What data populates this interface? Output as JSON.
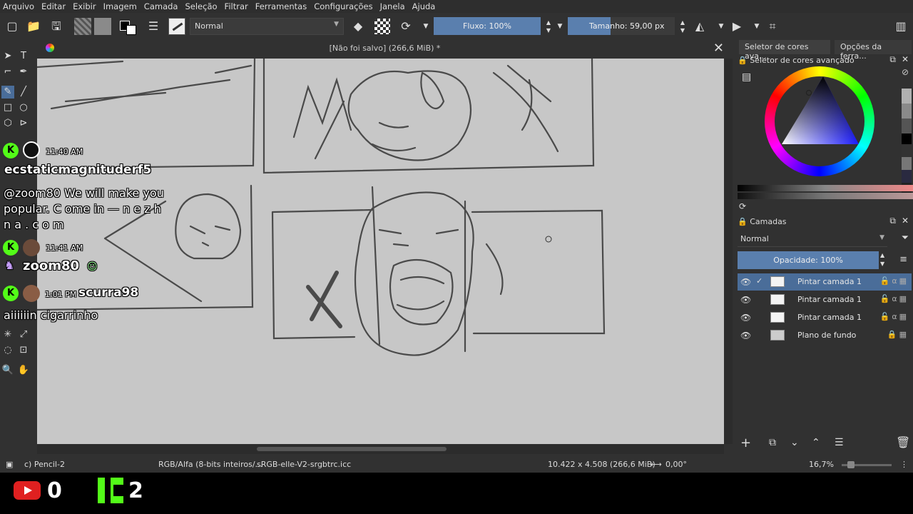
{
  "menu": [
    "Arquivo",
    "Editar",
    "Exibir",
    "Imagem",
    "Camada",
    "Seleção",
    "Filtrar",
    "Ferramentas",
    "Configurações",
    "Janela",
    "Ajuda"
  ],
  "toolbar": {
    "blend_mode": "Normal",
    "flow_label": "Fluxo: 100%",
    "size_label": "Tamanho: 59,00 px"
  },
  "document": {
    "title": "[Não foi salvo]  (266,6 MiB) *"
  },
  "docker": {
    "tab_color": "Seletor de cores ava...",
    "tab_tools": "Opções da ferra...",
    "color_selector_title": "Seletor de cores avançado",
    "layers_title": "Camadas",
    "layers_blend": "Normal",
    "opacity_label": "Opacidade:  100%",
    "layers": [
      {
        "name": "Pintar camada 1"
      },
      {
        "name": "Pintar camada 1"
      },
      {
        "name": "Pintar camada 1"
      },
      {
        "name": "Plano de fundo"
      }
    ]
  },
  "status": {
    "brush": "c) Pencil-2",
    "colorspace": "RGB/Alfa (8-bits inteiros/...",
    "profile": "sRGB-elle-V2-srgbtrc.icc",
    "dimensions": "10.422 x 4.508 (266,6 MiB)",
    "rotation": "0,00°",
    "zoom": "16,7%"
  },
  "chat": {
    "msg1_time": "11:40 AM",
    "msg1_user": "ecstaticmagnituderf5",
    "msg1_text": "@zoom80 We will make you popular. C ome in — n e z h n a . c o m",
    "msg2_time": "11:41 AM",
    "msg2_user": "zoom80",
    "msg3_time": "1:01 PM",
    "msg3_user": "scurra98",
    "msg3_text": "aiiiiiin cigarrinho"
  },
  "stream": {
    "youtube_count": "0",
    "kick_count": "2"
  },
  "colors": {
    "accent": "#5a7fae",
    "kick_green": "#53fc18",
    "youtube_red": "#e02020",
    "canvas": "#c7c7c7"
  }
}
